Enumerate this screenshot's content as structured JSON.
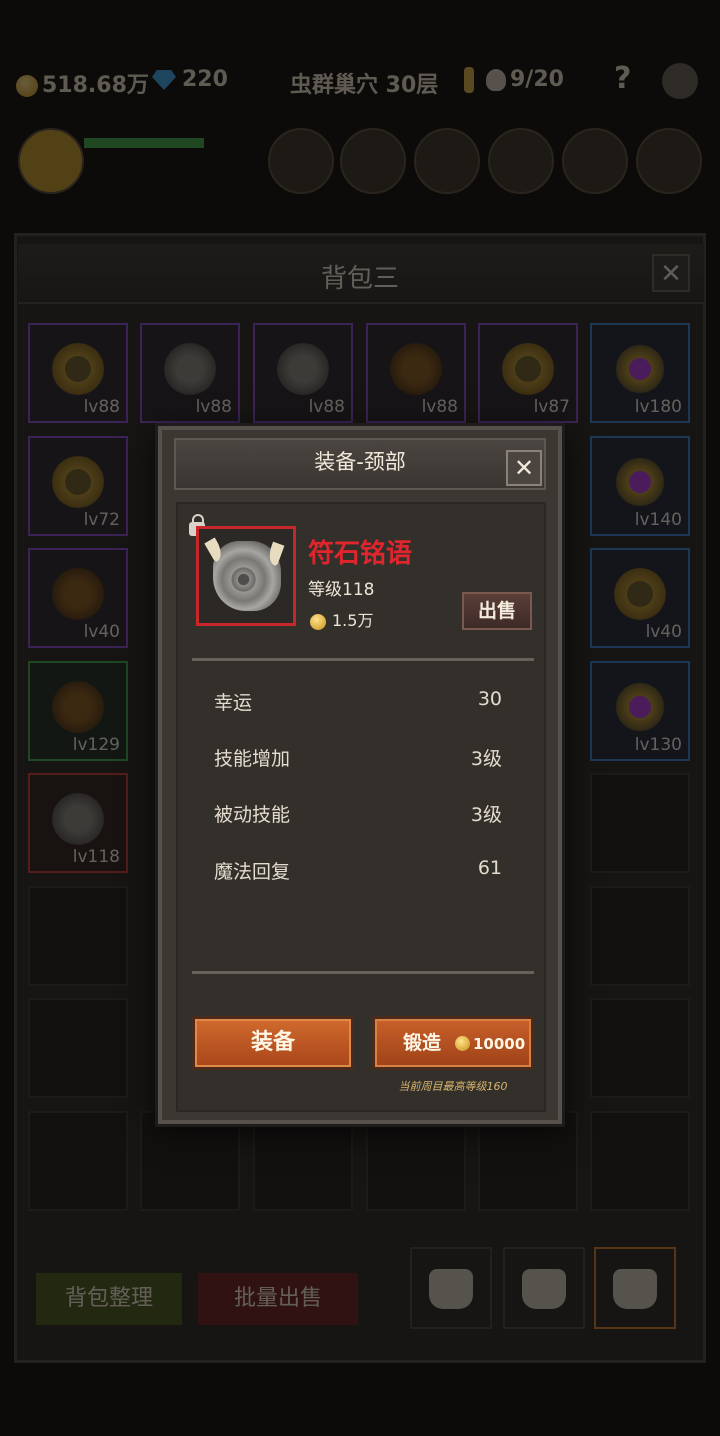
{
  "topbar": {
    "gold": "518.68万",
    "gems": "220",
    "dungeon": "虫群巢穴 30层",
    "keys": "9/20",
    "help": "?"
  },
  "bag": {
    "title": "背包三",
    "close_label": "✕",
    "slots": [
      {
        "level": "lv88"
      },
      {
        "level": "lv88"
      },
      {
        "level": "lv88"
      },
      {
        "level": "lv88"
      },
      {
        "level": "lv87"
      },
      {
        "level": "lv180"
      },
      {
        "level": "lv72"
      },
      {
        "level": "lv140"
      },
      {
        "level": "lv40"
      },
      {
        "level": "lv40"
      },
      {
        "level": "lv129"
      },
      {
        "level": "lv130"
      },
      {
        "level": "lv118"
      }
    ],
    "sort_label": "背包整理",
    "bulk_sell_label": "批量出售"
  },
  "dialog": {
    "title": "装备-颈部",
    "close_label": "✕",
    "item": {
      "name": "符石铭语",
      "level": "等级118",
      "price": "1.5万"
    },
    "sell_label": "出售",
    "stats": [
      {
        "name": "幸运",
        "value": "30"
      },
      {
        "name": "技能增加",
        "value": "3级"
      },
      {
        "name": "被动技能",
        "value": "3级"
      },
      {
        "name": "魔法回复",
        "value": "61"
      }
    ],
    "equip_label": "装备",
    "forge_label": "锻造",
    "forge_cost": "10000",
    "max_level_note": "当前周目最高等级160"
  },
  "colors": {
    "item_name": "#e0262c",
    "button_orange": "#c9602a",
    "rarity_red": "#c93a36",
    "rarity_purple": "#8a4bd0",
    "rarity_blue": "#3a7fd0",
    "rarity_green": "#3fa84a"
  }
}
